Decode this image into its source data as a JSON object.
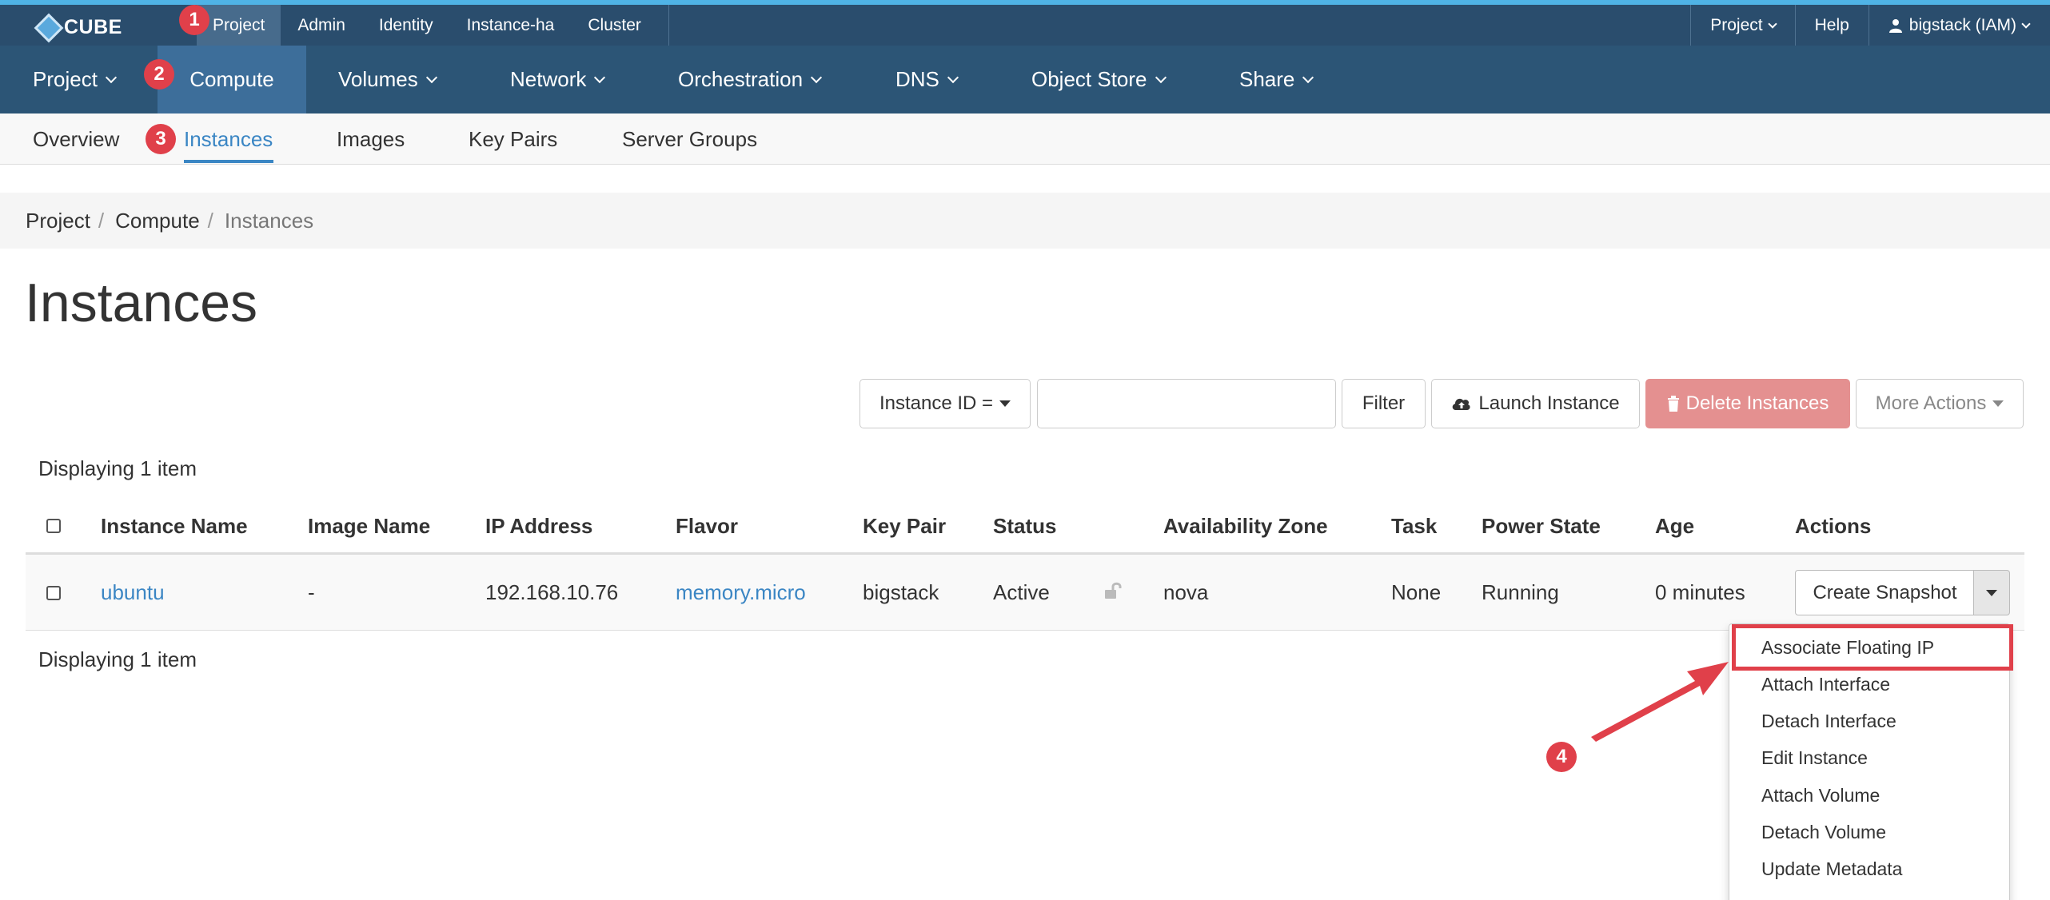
{
  "topbar": {
    "logo": "CUBE",
    "nav": [
      "Project",
      "Admin",
      "Identity",
      "Instance-ha",
      "Cluster"
    ],
    "right": {
      "project": "Project",
      "help": "Help",
      "user": "bigstack (IAM)"
    }
  },
  "mainnav": {
    "items": [
      "Project",
      "Compute",
      "Volumes",
      "Network",
      "Orchestration",
      "DNS",
      "Object Store",
      "Share"
    ]
  },
  "subnav": {
    "items": [
      "Overview",
      "Instances",
      "Images",
      "Key Pairs",
      "Server Groups"
    ]
  },
  "breadcrumb": [
    "Project",
    "Compute",
    "Instances"
  ],
  "page_title": "Instances",
  "toolbar": {
    "filter_select": "Instance ID =",
    "filter_input_value": "",
    "filter_button": "Filter",
    "launch_button": "Launch Instance",
    "delete_button": "Delete Instances",
    "more_button": "More Actions"
  },
  "display_count_top": "Displaying 1 item",
  "display_count_bottom": "Displaying 1 item",
  "table": {
    "columns": [
      "Instance Name",
      "Image Name",
      "IP Address",
      "Flavor",
      "Key Pair",
      "Status",
      "Availability Zone",
      "Task",
      "Power State",
      "Age",
      "Actions"
    ],
    "rows": [
      {
        "instance_name": "ubuntu",
        "image_name": "-",
        "ip_address": "192.168.10.76",
        "flavor": "memory.micro",
        "key_pair": "bigstack",
        "status": "Active",
        "availability_zone": "nova",
        "task": "None",
        "power_state": "Running",
        "age": "0 minutes",
        "action": "Create Snapshot"
      }
    ]
  },
  "action_menu": {
    "items": [
      "Associate Floating IP",
      "Attach Interface",
      "Detach Interface",
      "Edit Instance",
      "Attach Volume",
      "Detach Volume",
      "Update Metadata"
    ]
  },
  "annotations": [
    "1",
    "2",
    "3",
    "4"
  ],
  "colors": {
    "topbar": "#2a4d6d",
    "mainnav": "#2c5576",
    "accent": "#3b86c4",
    "danger": "#e49090",
    "annotation": "#e0404a"
  }
}
